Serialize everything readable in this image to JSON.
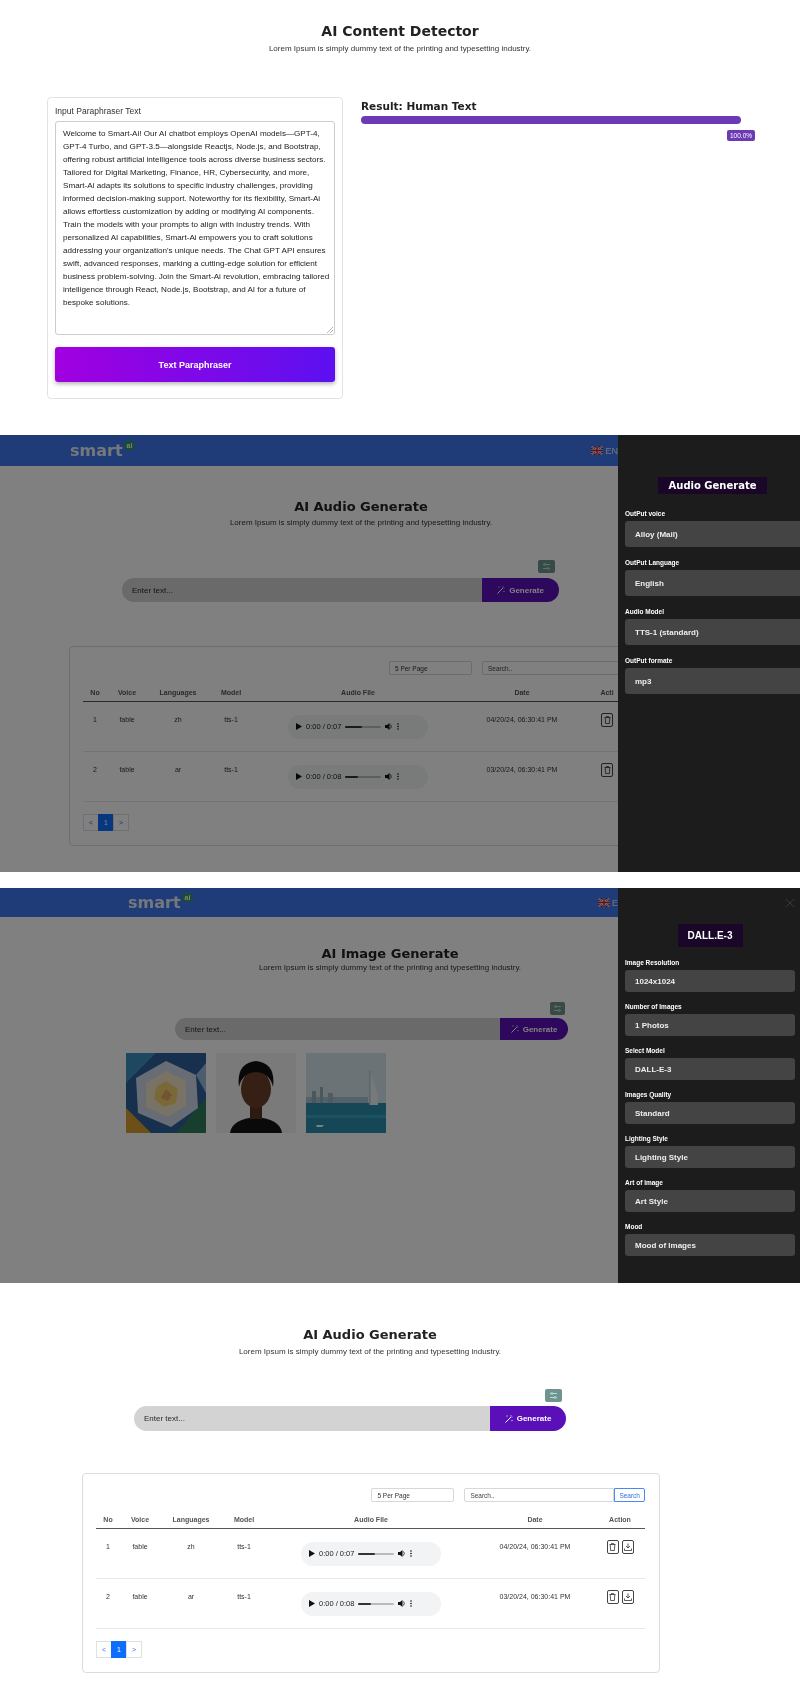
{
  "screens": [
    {
      "kind": "detector",
      "title": "AI Content Detector",
      "subtitle": "Lorem Ipsum is simply dummy text of the printing and typesetting industry.",
      "input": {
        "label": "Input Paraphraser Text",
        "value": "Welcome to Smart-Ai! Our AI chatbot employs OpenAI models—GPT-4, GPT-4 Turbo, and GPT-3.5—alongside Reactjs, Node.js, and Bootstrap, offering robust artificial intelligence tools across diverse business sectors. Tailored for Digital Marketing, Finance, HR, Cybersecurity, and more, Smart-Ai adapts its solutions to specific industry challenges, providing informed decision-making support. Noteworthy for its flexibility, Smart-Ai allows effortless customization by adding or modifying AI components. Train the models with your prompts to align with industry trends. With personalized AI capabilities, Smart-Ai empowers you to craft solutions addressing your organization's unique needs. The Chat GPT API ensures swift, advanced responses, marking a cutting-edge solution for efficient business problem-solving. Join the Smart-Ai revolution, embracing tailored intelligence through React, Node.js, Bootstrap, and AI for a future of bespoke solutions."
      },
      "submit_button": "Text Paraphraser",
      "result": {
        "label": "Result: Human Text",
        "level": 1,
        "reading": "100.0%"
      }
    },
    {
      "kind": "generator",
      "header": {
        "logo": "smart",
        "logo_badge": "ai",
        "language": "EN"
      },
      "title": "AI Audio Generate",
      "subtitle": "Lorem Ipsum is simply dummy text of the printing and typesetting industry.",
      "prompt": {
        "placeholder": "Enter text..."
      },
      "generate_button": "Generate",
      "table": {
        "per_page": "5 Per Page",
        "search": {
          "placeholder": "Search.."
        },
        "columns": [
          "No",
          "Voice",
          "Languages",
          "Model",
          "Audio File",
          "Date",
          "Acti"
        ],
        "row_actions": [
          {
            "kind": "delete"
          }
        ],
        "rows": [
          {
            "no": "1",
            "voice": "fable",
            "language": "zh",
            "model": "tts-1",
            "audio": {
              "time": "0:00 / 0:07",
              "level": 0.45
            },
            "date": "04/20/24, 06:30:41 PM"
          },
          {
            "no": "2",
            "voice": "fable",
            "language": "ar",
            "model": "tts-1",
            "audio": {
              "time": "0:00 / 0:08",
              "level": 0.35
            },
            "date": "03/20/24, 06:30:41 PM"
          }
        ],
        "pages": [
          {
            "label": "<",
            "selected": false
          },
          {
            "label": "1",
            "selected": true
          },
          {
            "label": ">",
            "selected": false
          }
        ]
      },
      "panel": {
        "title": "Audio Generate",
        "closable": false,
        "fields": [
          {
            "label": "OutPut voice",
            "value": "Alloy (Mail)"
          },
          {
            "label": "OutPut Language",
            "value": "English"
          },
          {
            "label": "Audio Model",
            "value": "TTS-1 (standard)"
          },
          {
            "label": "OutPut formate",
            "value": "mp3"
          }
        ]
      }
    },
    {
      "kind": "generator",
      "header": {
        "logo": "smart",
        "logo_badge": "ai",
        "language": "E"
      },
      "title": "AI Image Generate",
      "subtitle": "Lorem Ipsum is simply dummy text of the printing and typesetting industry.",
      "prompt": {
        "placeholder": "Enter text..."
      },
      "generate_button": "Generate",
      "panel": {
        "title": "DALL.E-3",
        "closable": true,
        "fields": [
          {
            "label": "Image Resolution",
            "value": "1024x1024"
          },
          {
            "label": "Number of Images",
            "value": "1 Photos"
          },
          {
            "label": "Select Model",
            "value": "DALL-E-3"
          },
          {
            "label": "Images Quality",
            "value": "Standard"
          },
          {
            "label": "Lighting Style",
            "value": "Lighting Style"
          },
          {
            "label": "Art of image",
            "value": "Art Style"
          },
          {
            "label": "Mood",
            "value": "Mood of Images"
          }
        ]
      }
    },
    {
      "kind": "generator",
      "title": "AI Audio Generate",
      "subtitle": "Lorem Ipsum is simply dummy text of the printing and typesetting industry.",
      "prompt": {
        "placeholder": "Enter text..."
      },
      "generate_button": "Generate",
      "table": {
        "per_page": "5 Per Page",
        "search": {
          "placeholder": "Search.."
        },
        "search_button": "Search",
        "columns": [
          "No",
          "Voice",
          "Languages",
          "Model",
          "Audio File",
          "Date",
          "Action"
        ],
        "row_actions": [
          {
            "kind": "delete"
          },
          {
            "kind": "download"
          }
        ],
        "rows": [
          {
            "no": "1",
            "voice": "fable",
            "language": "zh",
            "model": "tts-1",
            "audio": {
              "time": "0:00 / 0:07",
              "level": 0.45
            },
            "date": "04/20/24, 06:30:41 PM"
          },
          {
            "no": "2",
            "voice": "fable",
            "language": "ar",
            "model": "tts-1",
            "audio": {
              "time": "0:00 / 0:08",
              "level": 0.35
            },
            "date": "03/20/24, 06:30:41 PM"
          }
        ],
        "pages": [
          {
            "label": "<",
            "selected": false
          },
          {
            "label": "1",
            "selected": true
          },
          {
            "label": ">",
            "selected": false
          }
        ]
      }
    }
  ]
}
